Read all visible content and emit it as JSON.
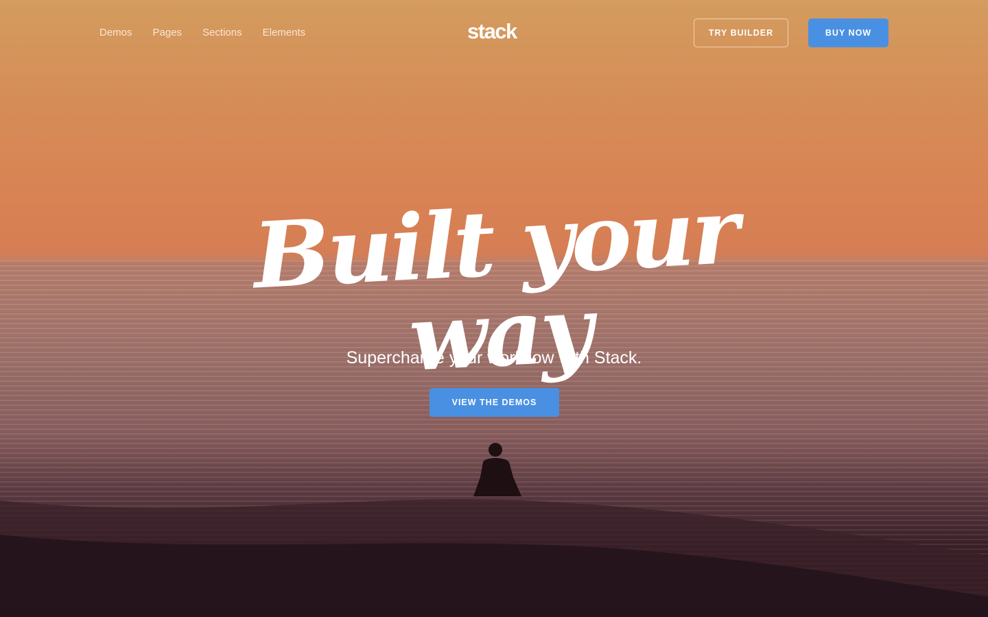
{
  "nav": {
    "links": [
      "Demos",
      "Pages",
      "Sections",
      "Elements"
    ],
    "logo": "stack",
    "try_builder": "TRY BUILDER",
    "buy_now": "BUY NOW"
  },
  "hero": {
    "title": "Built your way",
    "subtitle": "Supercharge your workflow with Stack.",
    "cta": "VIEW THE DEMOS"
  },
  "colors": {
    "accent": "#4a90e2"
  }
}
